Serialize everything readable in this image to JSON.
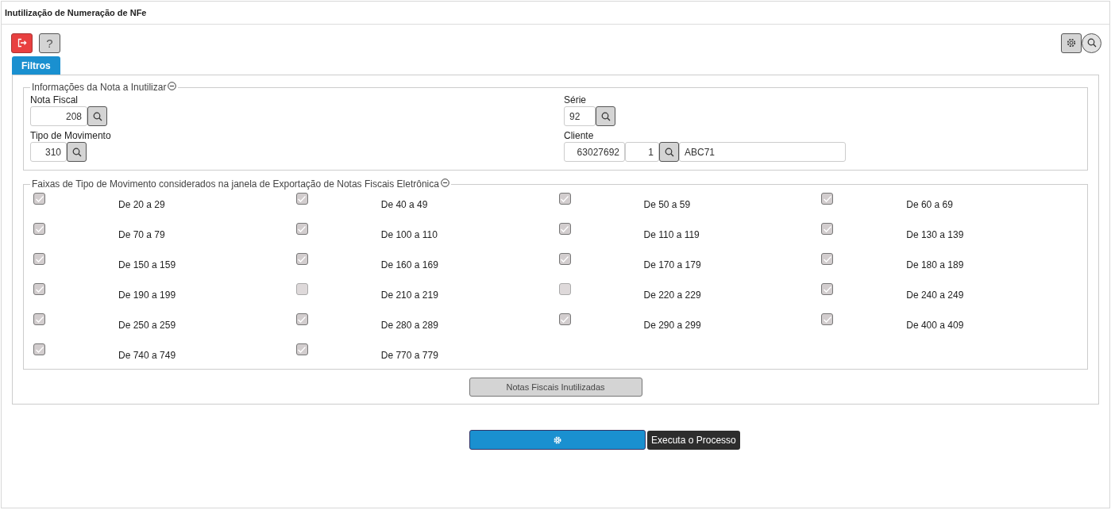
{
  "window": {
    "title": "Inutilização de Numeração de NFe"
  },
  "tabs": [
    {
      "label": "Filtros",
      "selected": true
    }
  ],
  "info_section": {
    "legend": "Informações da Nota a Inutilizar",
    "expanded": true,
    "nota_fiscal": {
      "label": "Nota Fiscal",
      "value": "208"
    },
    "serie": {
      "label": "Série",
      "value": "92"
    },
    "tipo_movimento": {
      "label": "Tipo de Movimento",
      "value": "310"
    },
    "cliente": {
      "label": "Cliente",
      "code": "63027692",
      "branch": "1",
      "name": "ABC71"
    }
  },
  "ranges_section": {
    "legend": "Faixas de Tipo de Movimento considerados na janela de Exportação de Notas Fiscais Eletrônica",
    "expanded": true,
    "items": [
      {
        "label": "De 20 a 29",
        "checked": true
      },
      {
        "label": "De 40 a 49",
        "checked": true
      },
      {
        "label": "De 50 a 59",
        "checked": true
      },
      {
        "label": "De 60 a 69",
        "checked": true
      },
      {
        "label": "De 70 a 79",
        "checked": true
      },
      {
        "label": "De 100 a 110",
        "checked": true
      },
      {
        "label": "De 110 a 119",
        "checked": true
      },
      {
        "label": "De 130 a 139",
        "checked": true
      },
      {
        "label": "De 150 a 159",
        "checked": true
      },
      {
        "label": "De 160 a 169",
        "checked": true
      },
      {
        "label": "De 170 a 179",
        "checked": true
      },
      {
        "label": "De 180 a 189",
        "checked": true
      },
      {
        "label": "De 190 a 199",
        "checked": true
      },
      {
        "label": "De 210 a 219",
        "checked": false
      },
      {
        "label": "De 220 a 229",
        "checked": false
      },
      {
        "label": "De 240 a 249",
        "checked": true
      },
      {
        "label": "De 250 a 259",
        "checked": true
      },
      {
        "label": "De 280 a 289",
        "checked": true
      },
      {
        "label": "De 290 a 299",
        "checked": true
      },
      {
        "label": "De 400 a 409",
        "checked": true
      },
      {
        "label": "De 740 a 749",
        "checked": true
      },
      {
        "label": "De 770 a 779",
        "checked": true
      }
    ]
  },
  "notas_button": "Notas Fiscais Inutilizadas",
  "help_button": "?",
  "tooltip": "Executa o Processo"
}
